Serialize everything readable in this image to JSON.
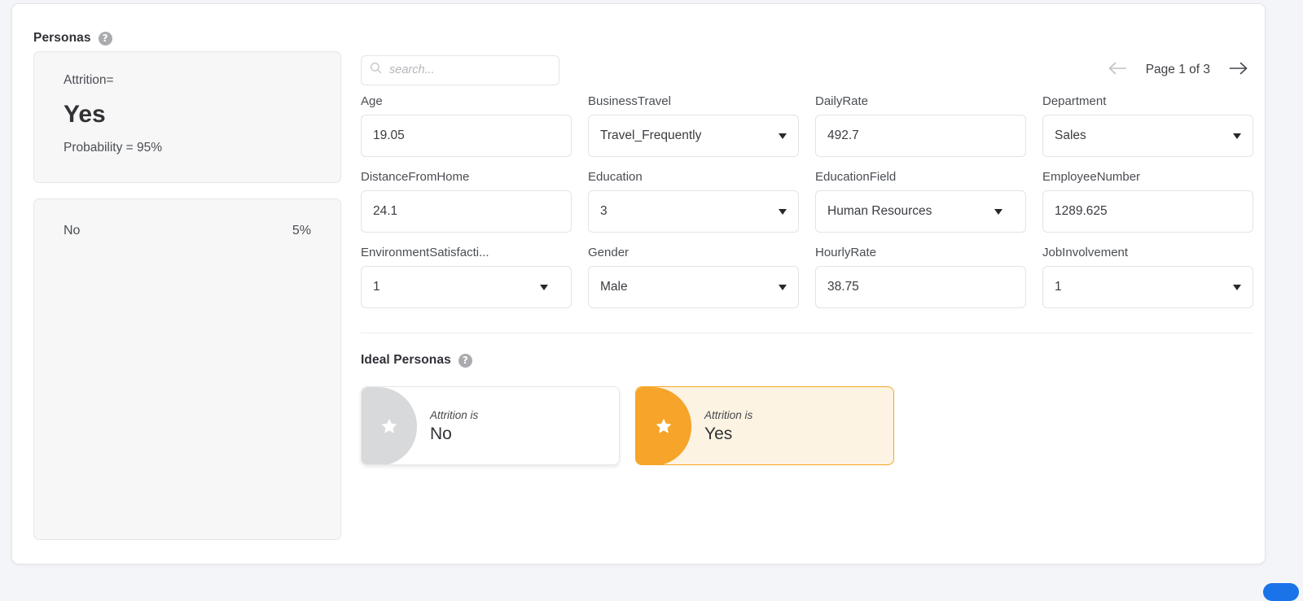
{
  "personas": {
    "title": "Personas",
    "help_icon": "help-circle-icon",
    "primary": {
      "prefix": "Attrition=",
      "value": "Yes",
      "probability": "Probability = 95%"
    },
    "secondary": {
      "label": "No",
      "percent": "5%"
    }
  },
  "search": {
    "placeholder": "search...",
    "value": "",
    "icon": "search-icon"
  },
  "pager": {
    "prev_icon": "arrow-left-icon",
    "next_icon": "arrow-right-icon",
    "label": "Page 1 of 3"
  },
  "fields": [
    {
      "label": "Age",
      "value": "19.05",
      "type": "text"
    },
    {
      "label": "BusinessTravel",
      "value": "Travel_Frequently",
      "type": "select"
    },
    {
      "label": "DailyRate",
      "value": "492.7",
      "type": "text"
    },
    {
      "label": "Department",
      "value": "Sales",
      "type": "select"
    },
    {
      "label": "DistanceFromHome",
      "value": "24.1",
      "type": "text"
    },
    {
      "label": "Education",
      "value": "3",
      "type": "select"
    },
    {
      "label": "EducationField",
      "value": "Human Resources",
      "type": "select"
    },
    {
      "label": "EmployeeNumber",
      "value": "1289.625",
      "type": "text"
    },
    {
      "label": "EnvironmentSatisfacti...",
      "value": "1",
      "type": "select"
    },
    {
      "label": "Gender",
      "value": "Male",
      "type": "select"
    },
    {
      "label": "HourlyRate",
      "value": "38.75",
      "type": "text"
    },
    {
      "label": "JobInvolvement",
      "value": "1",
      "type": "select"
    }
  ],
  "ideal_personas": {
    "title": "Ideal Personas",
    "help_icon": "help-circle-icon",
    "cards": [
      {
        "kicker": "Attrition is",
        "value": "No",
        "selected": false,
        "icon": "star-icon"
      },
      {
        "kicker": "Attrition is",
        "value": "Yes",
        "selected": true,
        "icon": "star-icon"
      }
    ]
  },
  "colors": {
    "accent": "#f6a42a",
    "accent_bg": "#fdf3e2",
    "inactive": "#d8d9da",
    "page_bg": "#f4f5f9"
  }
}
